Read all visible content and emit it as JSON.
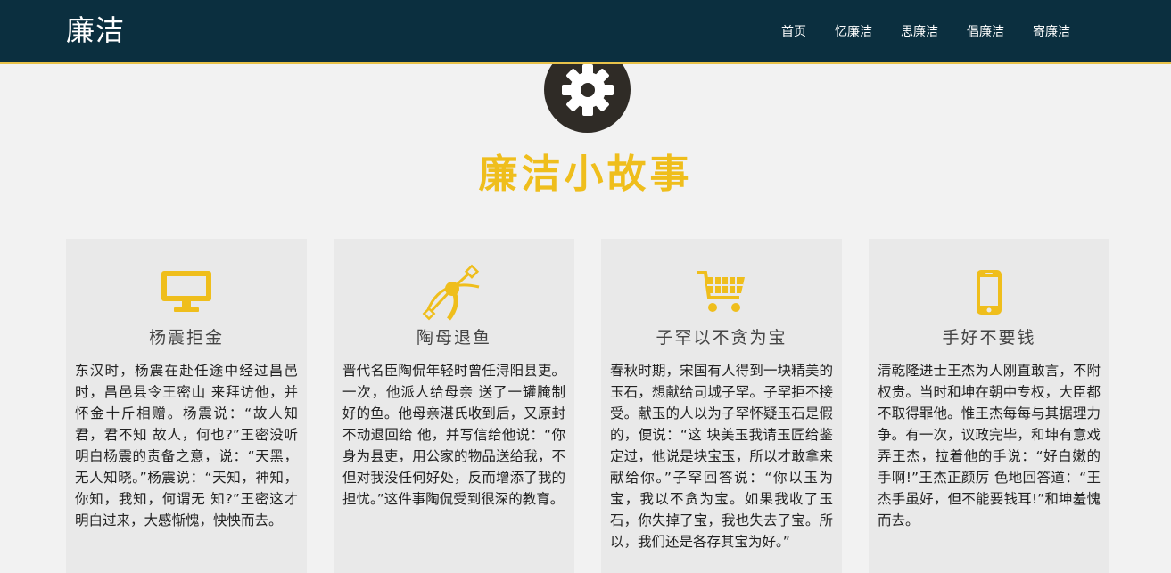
{
  "header": {
    "brand": "廉洁",
    "nav": [
      "首页",
      "忆廉洁",
      "思廉洁",
      "倡廉洁",
      "寄廉洁"
    ]
  },
  "hero": {
    "icon": "gear-icon",
    "title": "廉洁小故事"
  },
  "colors": {
    "navbar": "#0b2f3f",
    "accent": "#efbe1c",
    "hero_circle": "#2f2b26"
  },
  "cards": [
    {
      "icon": "monitor-icon",
      "title": "杨震拒金",
      "text": "东汉时，杨震在赴任途中经过昌邑时，昌邑县令王密山 来拜访他，并怀金十斤相赠。杨震说：“故人知君，君不知 故人，何也?”王密没听明白杨震的责备之意，说：“天黑，无人知晓。”杨震说：“天知，神知，你知，我知，何谓无 知?”王密这才明白过来，大感惭愧，怏怏而去。"
    },
    {
      "icon": "bezier-pen-icon",
      "title": "陶母退鱼",
      "text": "晋代名臣陶侃年轻时曾任浔阳县吏。一次，他派人给母亲 送了一罐腌制好的鱼。他母亲湛氏收到后，又原封不动退回给 他，并写信给他说：“你身为县吏，用公家的物品送给我，不 但对我没任何好处，反而增添了我的担忧。”这件事陶侃受到很深的教育。"
    },
    {
      "icon": "shopping-cart-icon",
      "title": "子罕以不贪为宝",
      "text": "春秋时期，宋国有人得到一块精美的玉石，想献给司城子罕。子罕拒不接受。献玉的人以为子罕怀疑玉石是假的，便说：“这 块美玉我请玉匠给鉴定过，他说是块宝玉，所以才敢拿来献给你。”子罕回答说：“你以玉为宝，我以不贪为宝。如果我收了玉石，你失掉了宝，我也失去了宝。所以，我们还是各存其宝为好。”"
    },
    {
      "icon": "mobile-phone-icon",
      "title": "手好不要钱",
      "text": "清乾隆进士王杰为人刚直敢言，不附权贵。当时和坤在朝中专权，大臣都不取得罪他。惟王杰每每与其据理力争。有一次，议政完毕，和坤有意戏弄王杰，拉着他的手说：“好白嫩的手啊!”王杰正颜厉 色地回答道：“王杰手虽好，但不能要钱耳!”和坤羞愧而去。"
    }
  ]
}
